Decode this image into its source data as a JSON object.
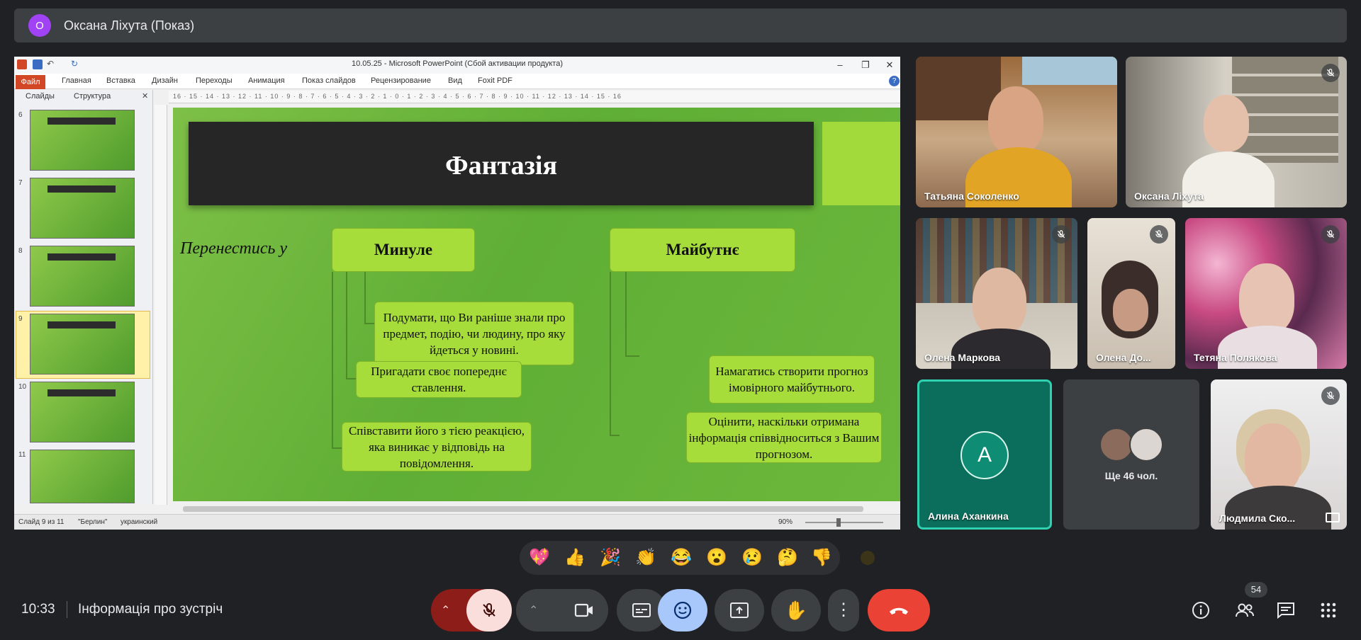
{
  "presenter": {
    "initial": "О",
    "label": "Оксана Ліхута (Показ)"
  },
  "ppt": {
    "window_title": "10.05.25 - Microsoft PowerPoint (Сбой активации продукта)",
    "ribbon_tabs": [
      "Файл",
      "Главная",
      "Вставка",
      "Дизайн",
      "Переходы",
      "Анимация",
      "Показ слайдов",
      "Рецензирование",
      "Вид",
      "Foxit PDF"
    ],
    "panel_tabs": [
      "Слайды",
      "Структура"
    ],
    "thumb_numbers": [
      "6",
      "7",
      "8",
      "9",
      "10",
      "11"
    ],
    "status": {
      "slide": "Слайд 9 из 11",
      "theme": "\"Берлин\"",
      "language": "украинский",
      "zoom": "90%"
    },
    "ruler_marks": "16 · 15 · 14 · 13 · 12 · 11 · 10 · 9 · 8 · 7 · 6 · 5 · 4 · 3 · 2 · 1 · 0 · 1 · 2 · 3 · 4 · 5 · 6 · 7 · 8 · 9 · 10 · 11 · 12 · 13 · 14 · 15 · 16"
  },
  "slide": {
    "title": "Фантазія",
    "lead": "Перенестись у",
    "past_head": "Минуле",
    "future_head": "Майбутнє",
    "past_items": [
      "Подумати, що Ви раніше знали про предмет, подію,  чи людину, про яку  йдеться у новині.",
      "Пригадати своє попереднє ставлення.",
      "Співставити його з тією реакцією, яка виникає у відповідь на  повідомлення."
    ],
    "future_items": [
      "Намагатись створити прогноз імовірного майбутнього.",
      "Оцінити, наскільки  отримана інформація  співвідноситься з Вашим прогнозом."
    ]
  },
  "participants": [
    {
      "name": "Татьяна Соколенко",
      "muted": false
    },
    {
      "name": "Оксана Ліхута",
      "muted": true
    },
    {
      "name": "Олена Маркова",
      "muted": true
    },
    {
      "name": "Олена До...",
      "muted": true
    },
    {
      "name": "Тетяна Полякова",
      "muted": true
    },
    {
      "name": "Алина Аханкина",
      "initial": "А",
      "muted": false
    },
    {
      "name": "Людмила Ско...",
      "muted": true
    }
  ],
  "others": {
    "label": "Ще 46 чол."
  },
  "reactions": [
    "💖",
    "👍",
    "🎉",
    "👏",
    "😂",
    "😮",
    "😢",
    "🤔",
    "👎"
  ],
  "bottom": {
    "time": "10:33",
    "meeting_info": "Інформація про зустріч",
    "people_count": "54"
  },
  "colors": {
    "accent_teal": "#1ea78b",
    "end_call": "#ea4335",
    "active_reactions": "#a8c7fa",
    "mic_off": "#f9dedc"
  }
}
